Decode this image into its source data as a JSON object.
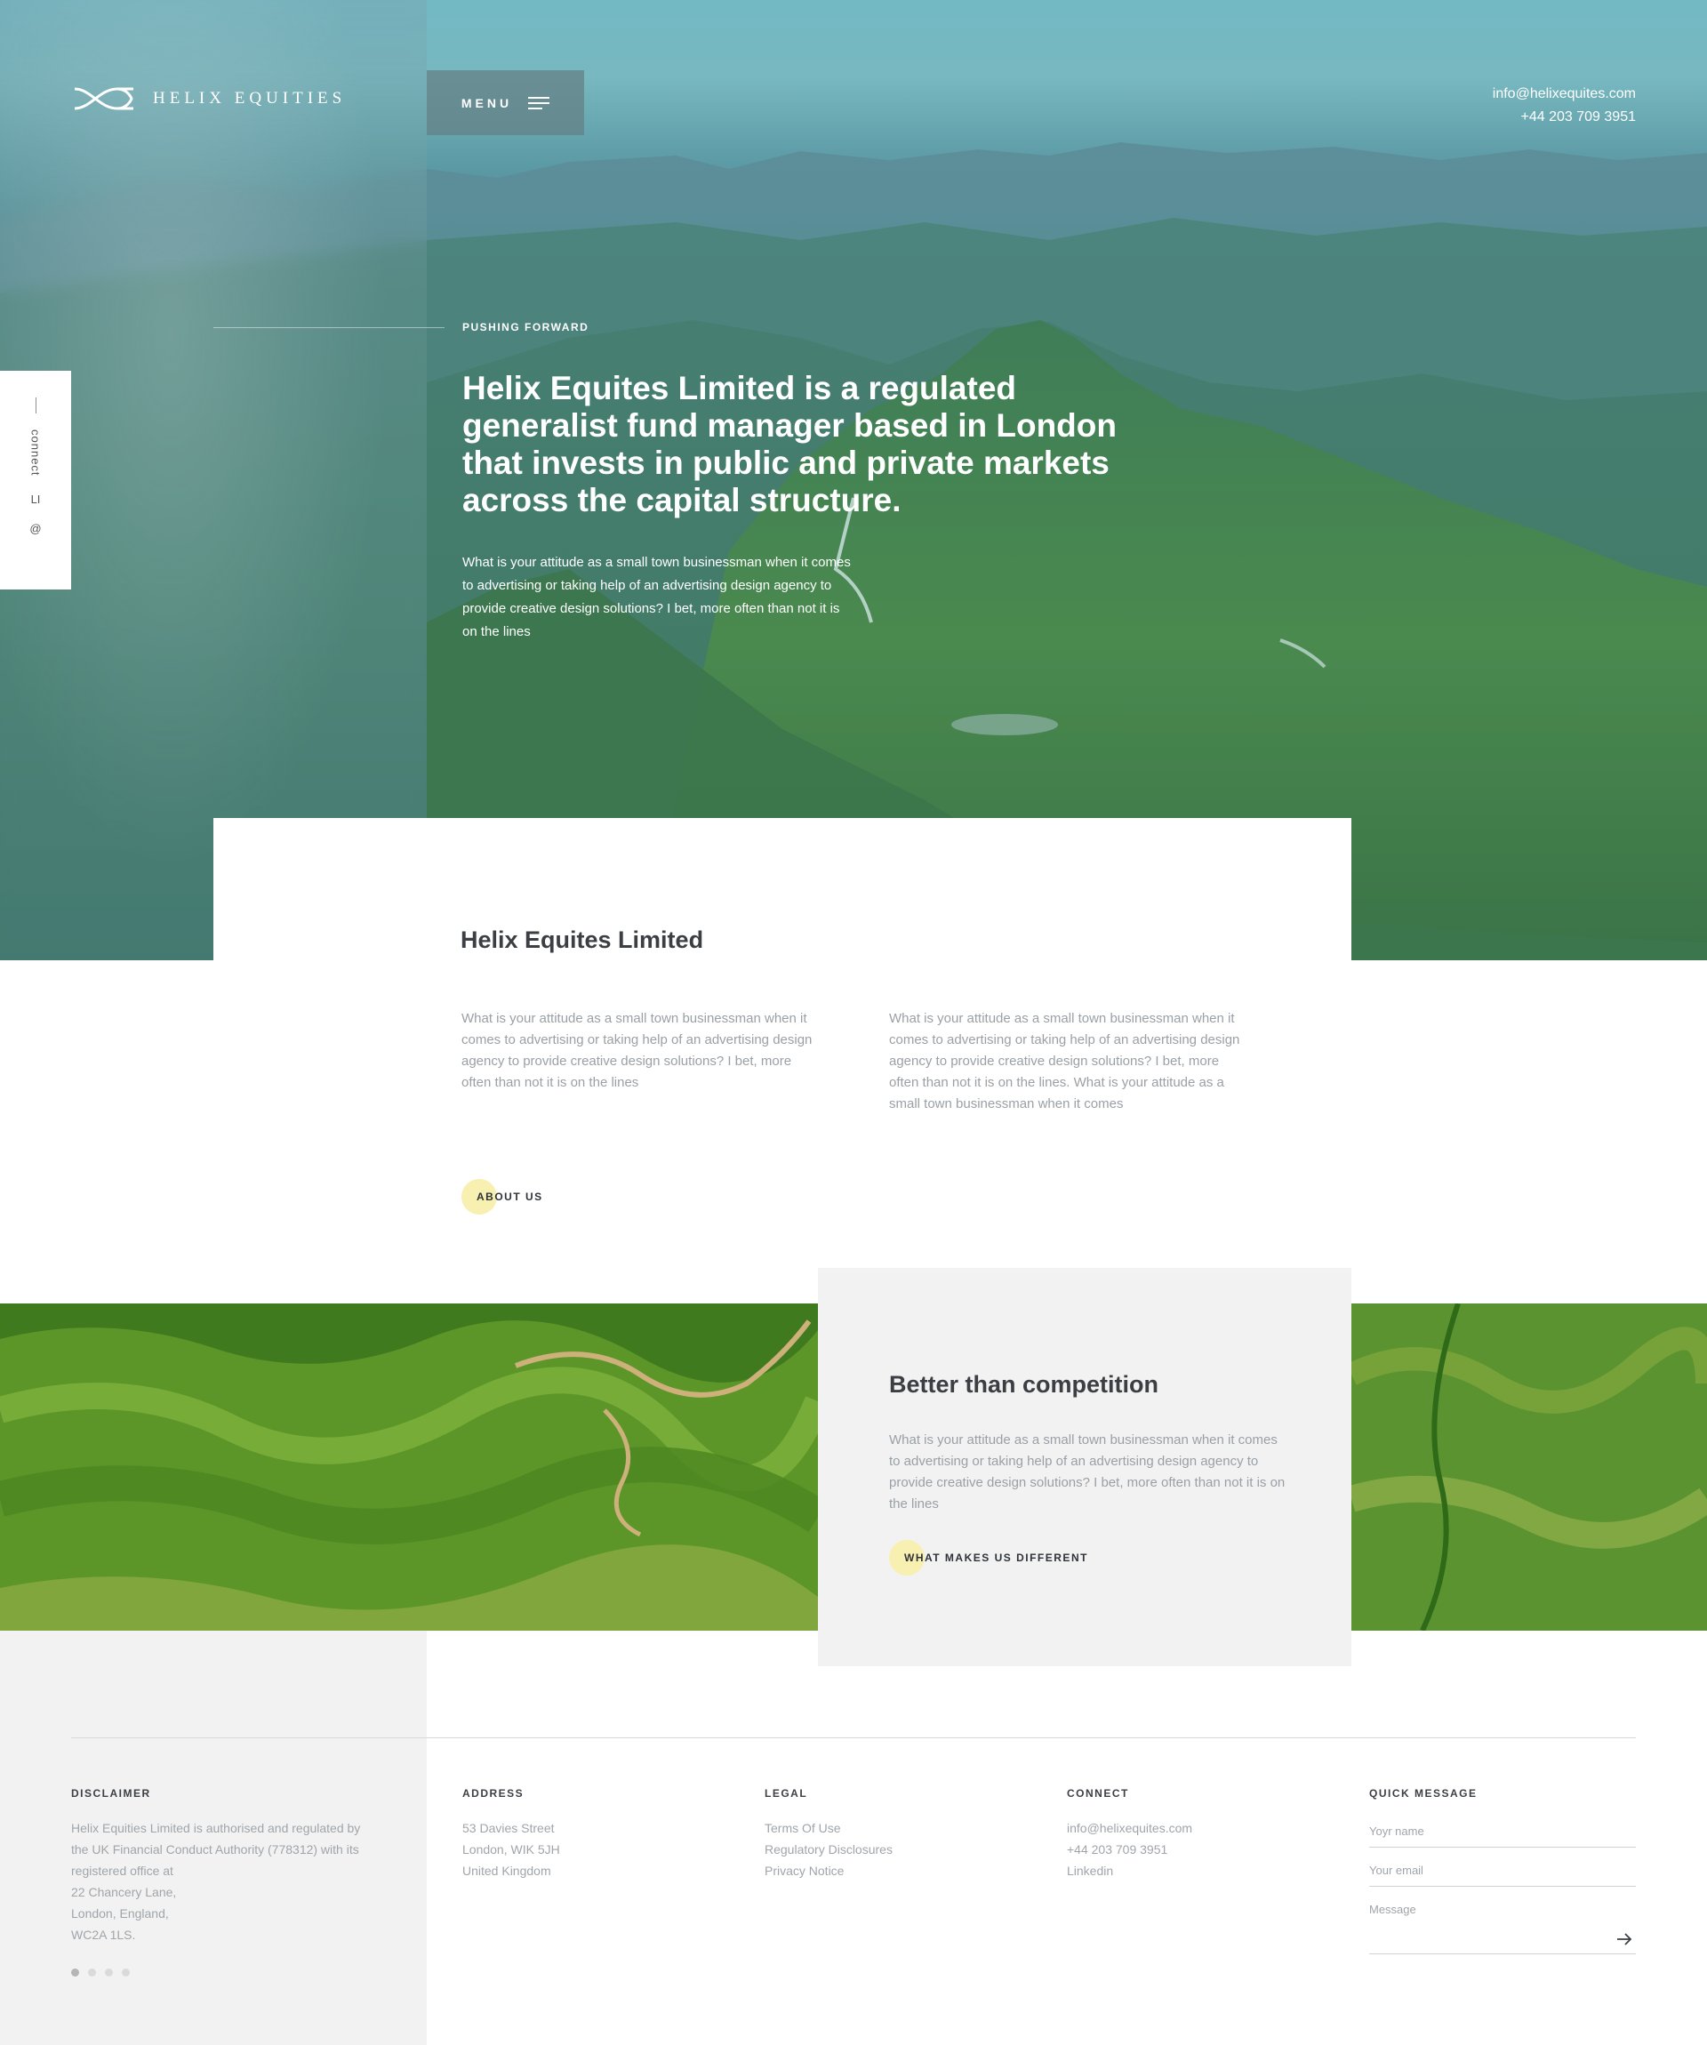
{
  "brand": {
    "name": "HELIX EQUITIES"
  },
  "nav": {
    "menu_label": "MENU"
  },
  "header": {
    "email": "info@helixequites.com",
    "phone": "+44 203 709 3951"
  },
  "side": {
    "connect_label": "connect",
    "linkedin": "LI",
    "email_icon": "@"
  },
  "hero": {
    "kicker": "PUSHING FORWARD",
    "title": "Helix Equites Limited is a regulated generalist fund manager based in London that invests in public and private markets across the capital structure.",
    "body": "What is your attitude as a small town businessman when it comes to advertising or taking help of an advertising design agency to provide creative design solutions? I bet, more often than not it is on the lines"
  },
  "about": {
    "title": "Helix Equites Limited",
    "col1": "What is your attitude as a small town businessman when it comes to advertising or taking help of an advertising design agency to provide creative design solutions? I bet, more often than not it is on the lines",
    "col2": "What is your attitude as a small town businessman when it comes to advertising or taking help of an advertising design agency to provide creative design solutions? I bet, more often than not it is on the lines. What is your attitude as a small town businessman when it comes",
    "cta": "ABOUT US"
  },
  "compete": {
    "title": "Better than competition",
    "body": "What is your attitude as a small town businessman when it comes to advertising or taking help of an advertising design agency to provide creative design solutions? I bet, more often than not it is on the lines",
    "cta": "WHAT MAKES US DIFFERENT"
  },
  "footer": {
    "disclaimer": {
      "heading": "DISCLAIMER",
      "lines": [
        "Helix Equities Limited is authorised and regulated by",
        "the UK Financial Conduct Authority (778312) with its",
        "registered office at",
        "22 Chancery Lane,",
        "London, England,",
        "WC2A 1LS."
      ]
    },
    "address": {
      "heading": "ADDRESS",
      "lines": [
        "53 Davies Street",
        "London, WIK 5JH",
        "United Kingdom"
      ]
    },
    "legal": {
      "heading": "LEGAL",
      "links": [
        "Terms Of Use",
        "Regulatory Disclosures",
        "Privacy Notice"
      ]
    },
    "connect": {
      "heading": "CONNECT",
      "links": [
        "info@helixequites.com",
        "+44 203 709 3951",
        "Linkedin"
      ]
    },
    "quick_message": {
      "heading": "QUICK MESSAGE",
      "name_placeholder": "Yoyr name",
      "email_placeholder": "Your email",
      "message_placeholder": "Message"
    },
    "pager": {
      "count": 4,
      "active": 1
    }
  },
  "colors": {
    "accent_dot": "#f7f0b0",
    "card_grey": "#f2f2f2",
    "text_dark": "#3b3f44",
    "text_muted": "#9aa0a5"
  },
  "icons": [
    "helix-logo-icon",
    "hamburger-icon",
    "arrow-right-icon"
  ]
}
